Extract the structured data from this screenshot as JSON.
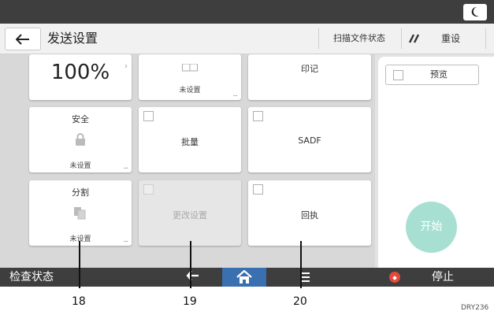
{
  "header": {
    "title": "发送设置",
    "scan_status": "扫描文件状态",
    "reset_label": "重设"
  },
  "tiles": {
    "scale_value": "100%",
    "top_middle_status": "未设置",
    "stamp_label": "印记",
    "security": {
      "title": "安全",
      "status": "未设置"
    },
    "batch_label": "批量",
    "sadf_label": "SADF",
    "divide": {
      "title": "分割",
      "status": "未设置"
    },
    "change_settings_label": "更改设置",
    "return_receipt_label": "回执"
  },
  "right_panel": {
    "preview_label": "预览",
    "start_label": "开始"
  },
  "bottom_bar": {
    "check_status": "检查状态",
    "stop_label": "停止"
  },
  "callouts": {
    "c18": "18",
    "c19": "19",
    "c20": "20"
  },
  "figure_code": "DRY236",
  "colors": {
    "bar": "#3e3e3e",
    "home_accent": "#3a6fb0",
    "start_button": "#a7e0d3",
    "stop_icon": "#e24a3b"
  },
  "icons": [
    "moon-icon",
    "back-arrow-icon",
    "reset-icon",
    "lock-icon",
    "copies-icon",
    "home-icon",
    "menu-icon",
    "stop-icon"
  ]
}
